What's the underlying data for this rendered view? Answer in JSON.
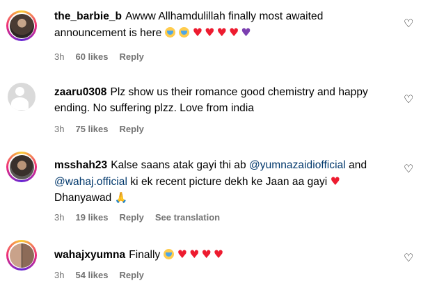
{
  "comments": [
    {
      "username": "the_barbie_b",
      "text": "Awww Allhamdulillah finally most awaited announcement is here",
      "emojis": [
        "😭",
        "😭",
        "❤️",
        "❤️",
        "❤️",
        "❤️",
        "💜"
      ],
      "time": "3h",
      "likes": "60 likes",
      "reply": "Reply"
    },
    {
      "username": "zaaru0308",
      "text": "Plz show us their romance good chemistry and happy ending. No suffering plzz. Love from india",
      "time": "3h",
      "likes": "75 likes",
      "reply": "Reply"
    },
    {
      "username": "msshah23",
      "text_before": "Kalse saans atak gayi thi ab",
      "mention1": "@yumnazaidiofficial",
      "text_and": "and",
      "mention2": "@wahaj.official",
      "text_after": "ki ek recent picture dekh ke Jaan aa gayi",
      "text_end": "Dhanyawad",
      "time": "3h",
      "likes": "19 likes",
      "reply": "Reply",
      "translation": "See translation"
    },
    {
      "username": "wahajxyumna",
      "text": "Finally",
      "time": "3h",
      "likes": "54 likes",
      "reply": "Reply"
    }
  ],
  "icons": {
    "like": "heart-outline-icon"
  },
  "colors": {
    "meta": "#737373",
    "mention": "#00376b",
    "heart": "#ed1b2f"
  }
}
